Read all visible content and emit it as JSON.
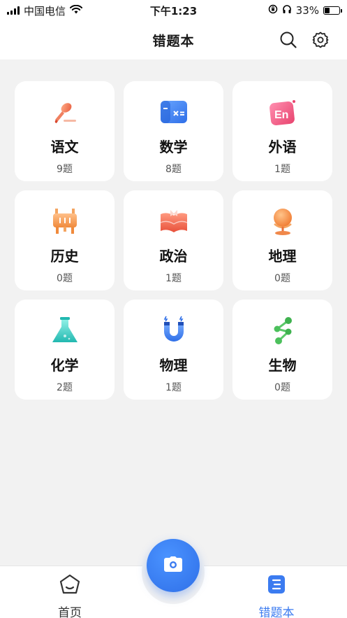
{
  "status_bar": {
    "carrier": "中国电信",
    "time": "下午1:23",
    "battery": "33%",
    "battery_level": 0.33
  },
  "nav": {
    "title": "错题本",
    "search_icon": "search-icon",
    "settings_icon": "gear-icon"
  },
  "subjects": [
    {
      "name": "语文",
      "count": "9题",
      "icon": "brush-icon"
    },
    {
      "name": "数学",
      "count": "8题",
      "icon": "calculator-icon"
    },
    {
      "name": "外语",
      "count": "1题",
      "icon": "en-icon"
    },
    {
      "name": "历史",
      "count": "0题",
      "icon": "ding-icon"
    },
    {
      "name": "政治",
      "count": "1题",
      "icon": "book-icon"
    },
    {
      "name": "地理",
      "count": "0题",
      "icon": "globe-icon"
    },
    {
      "name": "化学",
      "count": "2题",
      "icon": "flask-icon"
    },
    {
      "name": "物理",
      "count": "1题",
      "icon": "magnet-icon"
    },
    {
      "name": "生物",
      "count": "0题",
      "icon": "molecule-icon"
    }
  ],
  "tabbar": {
    "home_label": "首页",
    "wrong_label": "错题本",
    "camera_icon": "camera-icon"
  },
  "colors": {
    "accent": "#3b7bf0",
    "background": "#f2f2f2",
    "card": "#ffffff"
  }
}
